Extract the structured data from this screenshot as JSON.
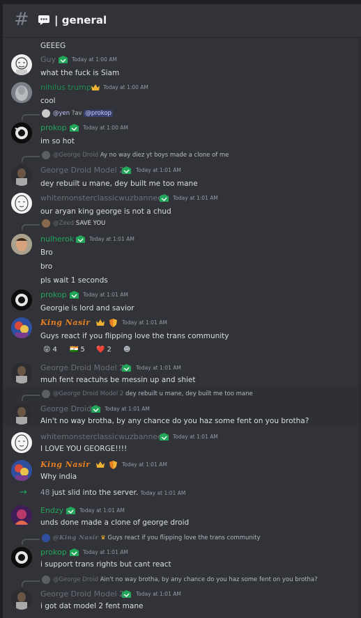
{
  "channel": {
    "hash": "#",
    "name": "| general"
  },
  "messages": {
    "m0": {
      "text": "GEEEG"
    },
    "m1": {
      "author": "Guy",
      "time": "Today at 1:00 AM",
      "text": "what the fuck is Siam"
    },
    "m2": {
      "author": "nihilus trump",
      "time": "Today at 1:00 AM",
      "text": "cool"
    },
    "m3": {
      "reply_name": "@yen",
      "reply_text": "?av",
      "reply_mention": "@prokop",
      "author": "prokop",
      "time": "Today at 1:00 AM",
      "text": "im so hot"
    },
    "m4": {
      "reply_name": "@George Droid",
      "reply_text": "Ay no way diez yt boys made a clone of me",
      "author": "George Droid Model 2",
      "time": "Today at 1:01 AM",
      "text": "dey rebuilt u mane, dey built me too mane"
    },
    "m5": {
      "author": "whitemonsterclassicwuzbanned",
      "time": "Today at 1:01 AM",
      "text": "our aryan king george is not a chud"
    },
    "m6": {
      "reply_name": "@Zeed",
      "reply_text": "SAVE YOU",
      "author": "nulherok",
      "time": "Today at 1:01 AM",
      "text1": "Bro",
      "text2": "bro",
      "text3": "pls wait 1 seconds"
    },
    "m7": {
      "author": "prokop",
      "time": "Today at 1:01 AM",
      "text": "Georgie is lord and savior"
    },
    "m8": {
      "author": "King Nasir",
      "time": "Today at 1:01 AM",
      "text": "Guys react if you flipping love the trans community",
      "reactions": [
        {
          "emoji": "😝",
          "count": "4"
        },
        {
          "emoji": "🇮🇳",
          "count": "5"
        },
        {
          "emoji": "❤️",
          "count": "2"
        },
        {
          "emoji": "☻",
          "count": ""
        }
      ]
    },
    "m9": {
      "author": "George Droid Model 2",
      "time": "Today at 1:01 AM",
      "text": "muh fent reactuhs be messin up and shiet"
    },
    "m10": {
      "reply_name": "@George Droid Model 2",
      "reply_text": "dey rebuilt u mane, dey built me too mane",
      "author": "George Droid",
      "time": "Today at 1:01 AM",
      "text": "Ain't no way brotha, by any chance do you haz some fent on you brotha?"
    },
    "m11": {
      "author": "whitemonsterclassicwuzbanned",
      "time": "Today at 1:01 AM",
      "text": "I LOVE YOU GEORGE!!!!"
    },
    "m12": {
      "author": "King Nasir",
      "time": "Today at 1:01 AM",
      "text": "Why india"
    },
    "m13": {
      "arrow": "→",
      "who": "48",
      "text": "just slid into the server.",
      "time": "Today at 1:01 AM"
    },
    "m14": {
      "author": "Endzy",
      "time": "Today at 1:01 AM",
      "text": "unds done made a clone of george droid"
    },
    "m15": {
      "reply_name": "@King Nasir",
      "reply_text": "Guys react if you flipping love the trans community",
      "author": "prokop",
      "time": "Today at 1:01 AM",
      "text": "i support trans rights but cant react"
    },
    "m16": {
      "reply_name": "@George Droid",
      "reply_text": "Ain't no way brotha, by any chance do you haz some fent on you brotha?",
      "author": "George Droid Model 2",
      "time": "Today at 1:01 AM",
      "text": "i got dat model 2 fent mane"
    }
  },
  "colors": {
    "bg": "#313338",
    "name_green": "#23a55a",
    "name_gray": "#6d6f78",
    "king": "#e67e22",
    "mention_bg": "#3c4270"
  },
  "icons": {
    "channel": "hash-icon",
    "badge": "green-role-badge-icon",
    "crown": "crown-icon",
    "shield": "shield-icon"
  }
}
